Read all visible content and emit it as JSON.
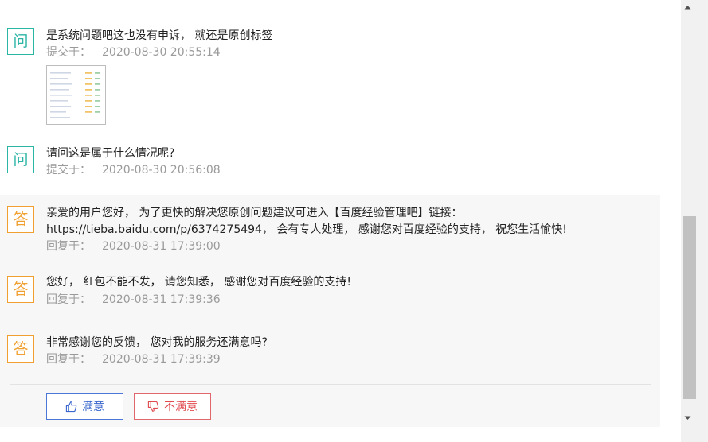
{
  "questions": [
    {
      "badge": "问",
      "text": "是系统问题吧这也没有申诉， 就还是原创标签",
      "meta_label": "提交于：",
      "time": "2020-08-30 20:55:14"
    },
    {
      "badge": "问",
      "text": "请问这是属于什么情况呢?",
      "meta_label": "提交于：",
      "time": "2020-08-30 20:56:08"
    }
  ],
  "answers": [
    {
      "badge": "答",
      "line1": "亲爱的用户您好， 为了更快的解决您原创问题建议可进入【百度经验管理吧】链接：",
      "line2": "https://tieba.baidu.com/p/6374275494， 会有专人处理， 感谢您对百度经验的支持， 祝您生活愉快!",
      "meta_label": "回复于：",
      "time": "2020-08-31 17:39:00"
    },
    {
      "badge": "答",
      "text": "您好， 红包不能不发， 请您知悉， 感谢您对百度经验的支持!",
      "meta_label": "回复于：",
      "time": "2020-08-31 17:39:36"
    },
    {
      "badge": "答",
      "text": "非常感谢您的反馈， 您对我的服务还满意吗?",
      "meta_label": "回复于：",
      "time": "2020-08-31 17:39:39"
    }
  ],
  "feedback": {
    "satisfied_label": "满意",
    "unsatisfied_label": "不满意"
  },
  "icons": {
    "satisfied": "thumbs-up-icon",
    "unsatisfied": "thumbs-down-icon"
  },
  "colors": {
    "question_accent": "#2bb5a5",
    "answer_accent": "#f0a030",
    "satisfied": "#3a66cc",
    "unsatisfied": "#e04b50",
    "answer_bg": "#f7f7f7"
  }
}
